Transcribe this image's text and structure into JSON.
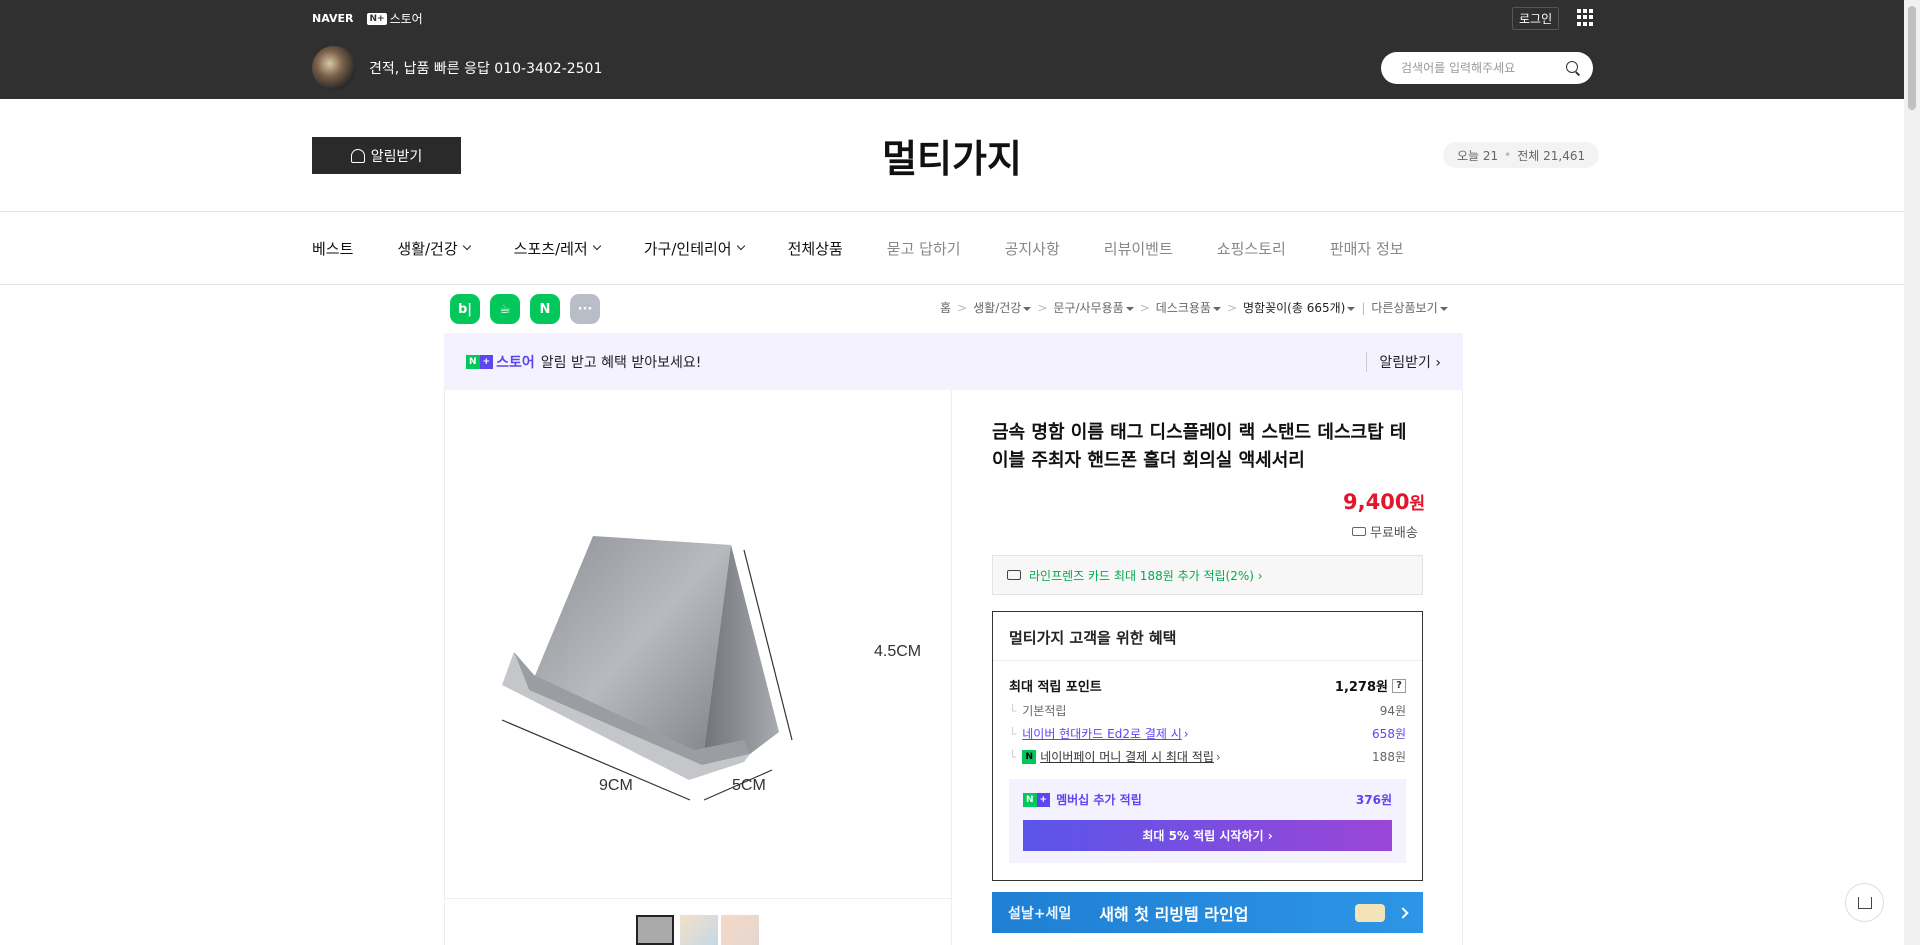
{
  "topbar": {
    "naver": "NAVER",
    "nplus_badge": "N+",
    "nplus_store": "스토어",
    "login": "로그인",
    "contact": "견적, 납품 빠른 응답 010-3402-2501",
    "search_placeholder": "검색어를 입력해주세요"
  },
  "store": {
    "alarm_button": "알림받기",
    "title": "멀티가지",
    "today_label": "오늘 21",
    "total_label": "전체 21,461"
  },
  "nav": {
    "items": [
      {
        "label": "베스트"
      },
      {
        "label": "생활/건강"
      },
      {
        "label": "스포츠/레저"
      },
      {
        "label": "가구/인테리어"
      },
      {
        "label": "전체상품"
      },
      {
        "label": "묻고 답하기"
      },
      {
        "label": "공지사항"
      },
      {
        "label": "리뷰이벤트"
      },
      {
        "label": "쇼핑스토리"
      },
      {
        "label": "판매자 정보"
      }
    ]
  },
  "share": {
    "blog": "b|",
    "cafe": "☕",
    "bookmark": "N"
  },
  "breadcrumb": {
    "home": "홈",
    "c1": "생활/건강",
    "c2": "문구/사무용품",
    "c3": "데스크용품",
    "c4": "명함꽂이(총 665개)",
    "other": "다른상품보기"
  },
  "banner": {
    "n": "N",
    "plus": "+",
    "store": "스토어",
    "text": "알림 받고 혜택 받아보세요!",
    "alarm": "알림받기 ›"
  },
  "product": {
    "title": "금속 명함 이름 태그 디스플레이 랙 스탠드 데스크탑 테이블 주최자 핸드폰 홀더 회의실 액세서리",
    "price": "9,400",
    "currency": "원",
    "shipping": "무료배송",
    "card_offer": "라인프렌즈 카드 최대 188원 추가 적립(2%) ›",
    "image_labels": {
      "w": "9CM",
      "d": "5CM",
      "h": "4.5CM"
    }
  },
  "benefit": {
    "title": "멀티가지 고객을 위한 혜택",
    "max_label": "최대 적립 포인트",
    "max_value": "1,278원",
    "q": "?",
    "base_label": "기본적립",
    "base_value": "94원",
    "card_label": "네이버 현대카드 Ed2로 결제 시",
    "card_value": "658원",
    "pay_icon": "N",
    "pay_label": "네이버페이 머니 결제 시 최대 적립",
    "pay_value": "188원",
    "member_label": "멤버십 추가 적립",
    "member_value": "376원",
    "member_button": "최대 5% 적립 시작하기 ›"
  },
  "promo": {
    "a": "설날+세일",
    "b": "새해 첫 리빙템 라인업"
  },
  "colors": {
    "accent_purple": "#5b46f0",
    "naver_green": "#03c75a",
    "price_red": "#e1152c"
  }
}
